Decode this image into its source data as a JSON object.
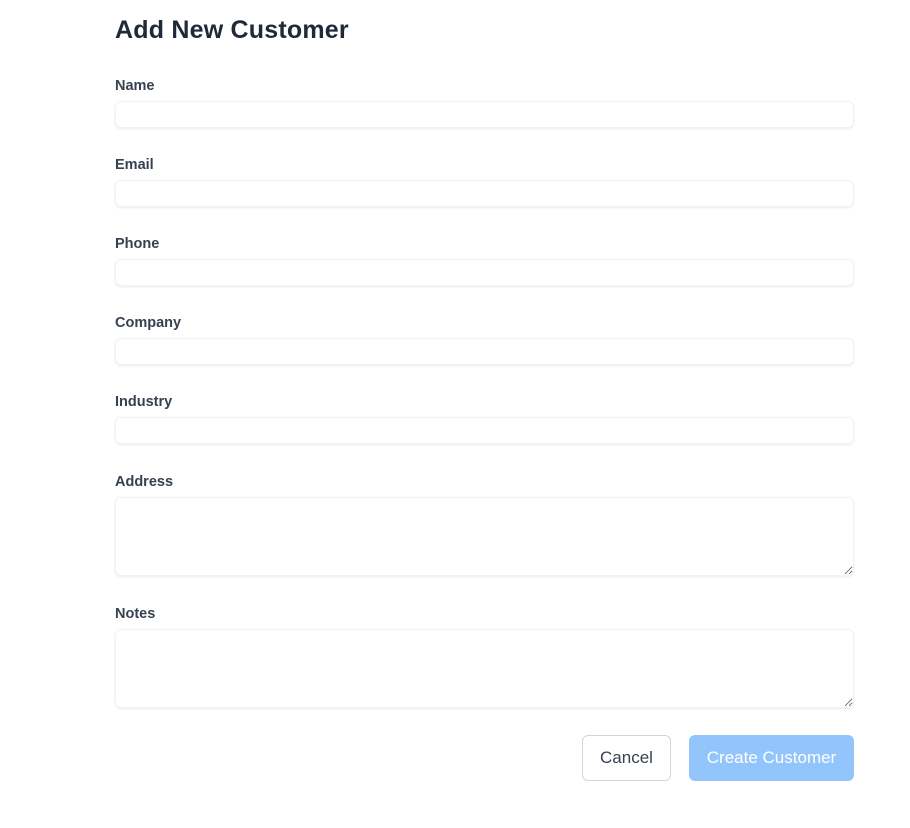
{
  "page": {
    "title": "Add New Customer"
  },
  "form": {
    "fields": {
      "name": {
        "label": "Name",
        "value": "",
        "placeholder": ""
      },
      "email": {
        "label": "Email",
        "value": "",
        "placeholder": ""
      },
      "phone": {
        "label": "Phone",
        "value": "",
        "placeholder": ""
      },
      "company": {
        "label": "Company",
        "value": "",
        "placeholder": ""
      },
      "industry": {
        "label": "Industry",
        "value": "",
        "placeholder": ""
      },
      "address": {
        "label": "Address",
        "value": "",
        "placeholder": ""
      },
      "notes": {
        "label": "Notes",
        "value": "",
        "placeholder": ""
      }
    },
    "actions": {
      "cancel_label": "Cancel",
      "create_label": "Create Customer"
    }
  },
  "colors": {
    "primary_disabled": "#93c5fd",
    "text_heading": "#1f2937",
    "text_label": "#374151",
    "border_light": "#f1f2f4"
  }
}
